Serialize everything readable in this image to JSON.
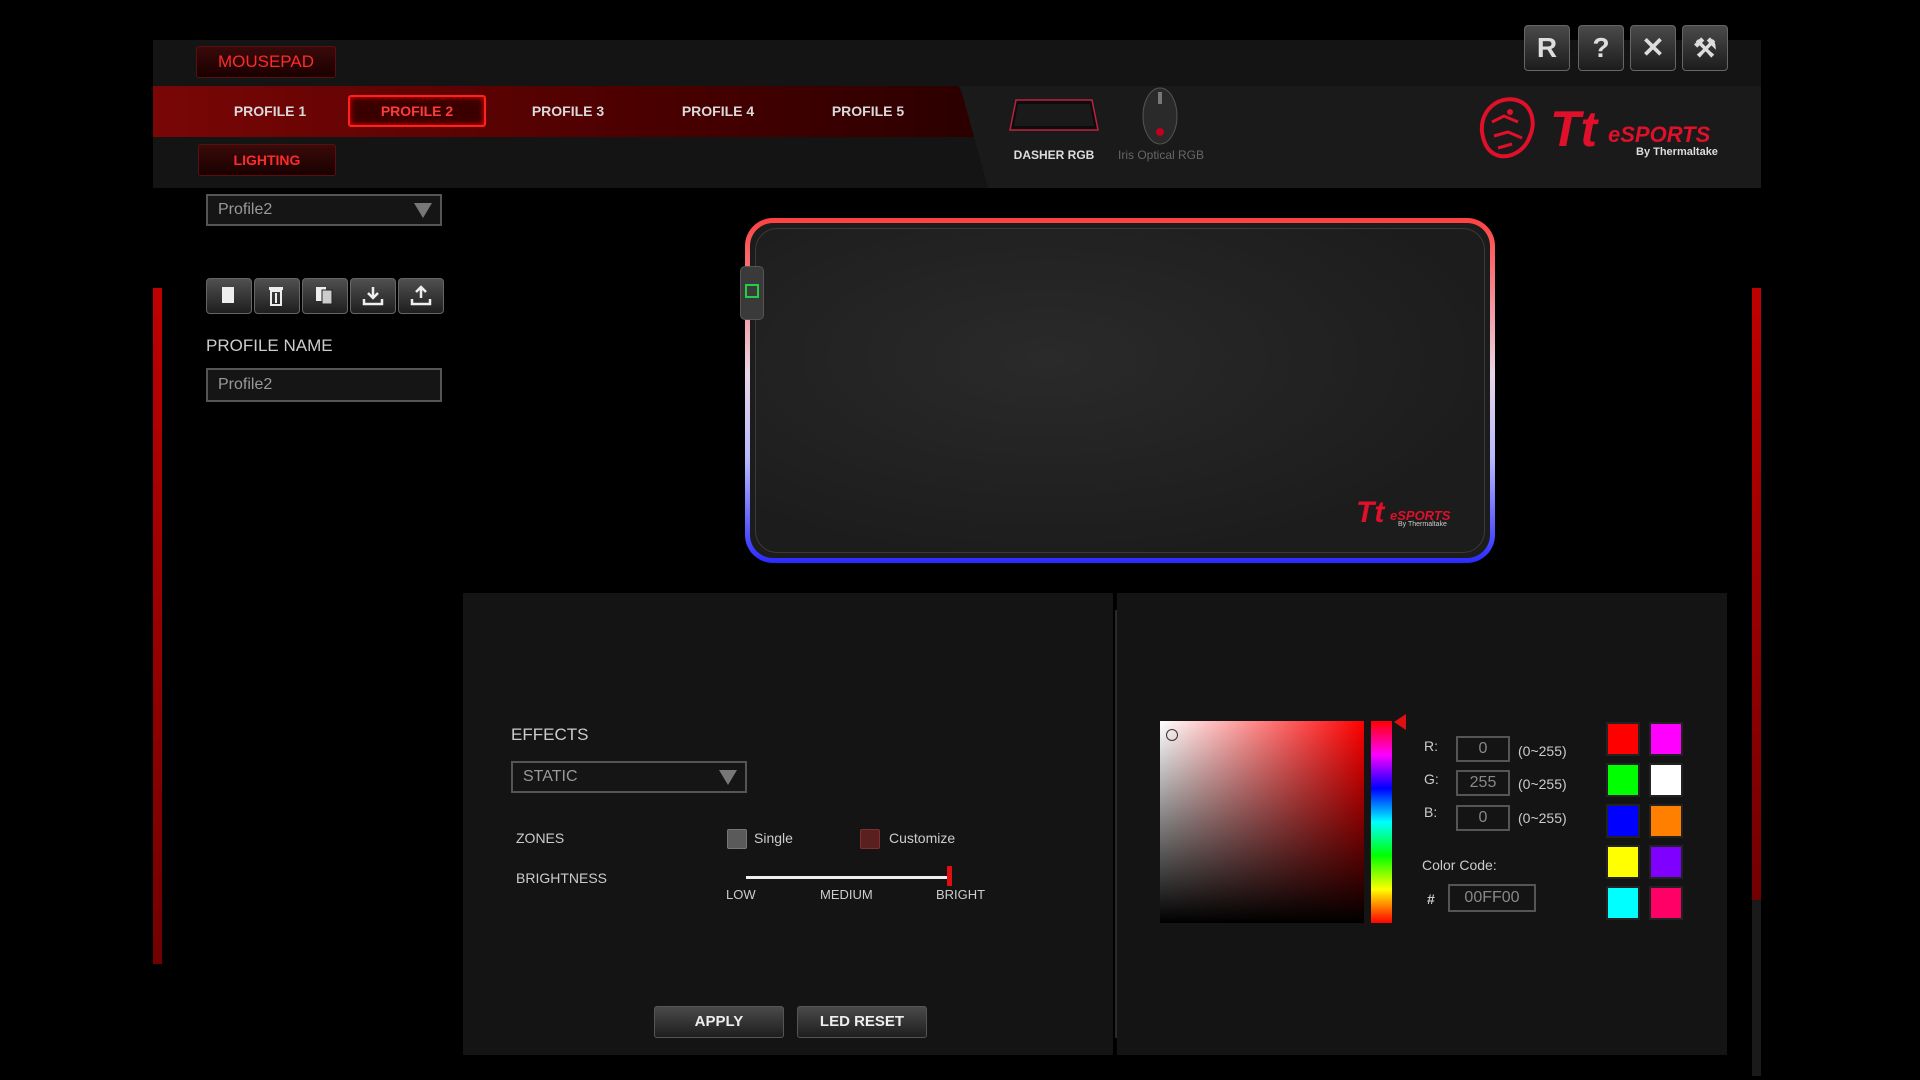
{
  "header": {
    "device_type": "MOUSEPAD",
    "mode": "LIGHTING",
    "profiles": [
      "PROFILE 1",
      "PROFILE 2",
      "PROFILE 3",
      "PROFILE 4",
      "PROFILE 5"
    ],
    "active_profile_index": 1,
    "window_buttons": [
      "R",
      "?",
      "✕",
      "⚒"
    ],
    "devices": [
      {
        "label": "DASHER RGB",
        "active": true
      },
      {
        "label": "Iris Optical RGB",
        "active": false
      }
    ],
    "brand": {
      "main": "Tt",
      "sub": "eSPORTS",
      "byline": "By Thermaltake"
    }
  },
  "sidebar": {
    "profile_select": "Profile2",
    "tool_icons": [
      "new-profile-icon",
      "delete-icon",
      "copy-icon",
      "import-icon",
      "export-icon"
    ],
    "profile_name_label": "PROFILE NAME",
    "profile_name_value": "Profile2"
  },
  "effects": {
    "label": "EFFECTS",
    "selected": "STATIC",
    "zones_label": "ZONES",
    "zone_single": "Single",
    "zone_customize": "Customize",
    "brightness_label": "BRIGHTNESS",
    "brightness_levels": [
      "LOW",
      "MEDIUM",
      "BRIGHT"
    ],
    "brightness_fraction": 1.0
  },
  "actions": {
    "apply": "APPLY",
    "led_reset": "LED RESET"
  },
  "color": {
    "r_label": "R:",
    "g_label": "G:",
    "b_label": "B:",
    "r": "0",
    "g": "255",
    "b": "0",
    "range": "(0~255)",
    "code_label": "Color Code:",
    "hash": "#",
    "code": "00FF00",
    "swatches": [
      "#ff0000",
      "#ff00ff",
      "#00ff00",
      "#ffffff",
      "#0000ff",
      "#ff8000",
      "#ffff00",
      "#8000ff",
      "#00ffff",
      "#ff0066"
    ]
  },
  "pad_brand": {
    "main": "Tt",
    "sub": "eSPORTS",
    "byline": "By Thermaltake"
  }
}
